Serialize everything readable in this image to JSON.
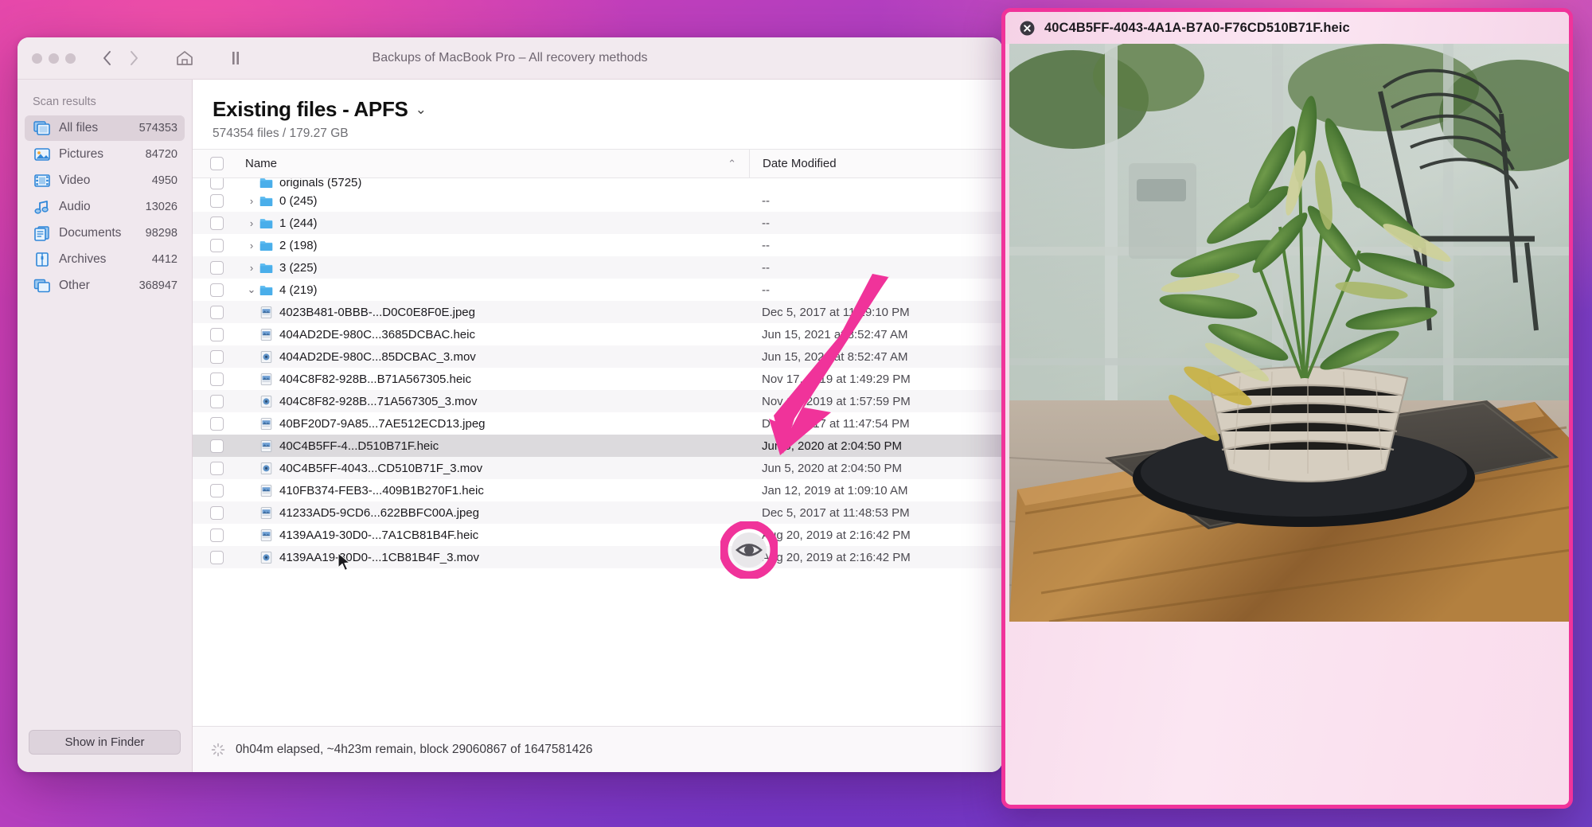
{
  "window": {
    "title": "Backups of MacBook Pro – All recovery methods",
    "toolbar": {
      "back_icon": "chevron-left-icon",
      "forward_icon": "chevron-right-icon",
      "home_icon": "home-icon",
      "pause_icon": "pause-icon"
    }
  },
  "sidebar": {
    "heading": "Scan results",
    "items": [
      {
        "label": "All files",
        "count": "574353",
        "icon": "all-files-icon",
        "selected": true
      },
      {
        "label": "Pictures",
        "count": "84720",
        "icon": "pictures-icon",
        "selected": false
      },
      {
        "label": "Video",
        "count": "4950",
        "icon": "video-icon",
        "selected": false
      },
      {
        "label": "Audio",
        "count": "13026",
        "icon": "audio-icon",
        "selected": false
      },
      {
        "label": "Documents",
        "count": "98298",
        "icon": "documents-icon",
        "selected": false
      },
      {
        "label": "Archives",
        "count": "4412",
        "icon": "archives-icon",
        "selected": false
      },
      {
        "label": "Other",
        "count": "368947",
        "icon": "other-icon",
        "selected": false
      }
    ],
    "show_in_finder": "Show in Finder"
  },
  "main": {
    "title": "Existing files - APFS",
    "title_chevron": "chevron-down-icon",
    "subtitle": "574354 files / 179.27 GB",
    "columns": {
      "name": "Name",
      "date": "Date Modified",
      "sort_caret": "caret-up-icon"
    },
    "rows": [
      {
        "name": "originals (5725)",
        "date": "",
        "type": "folder",
        "indent": 1,
        "twisty": "",
        "clipped": true,
        "alt": false
      },
      {
        "name": "0 (245)",
        "date": "--",
        "type": "folder",
        "indent": 1,
        "twisty": "collapsed",
        "alt": false
      },
      {
        "name": "1 (244)",
        "date": "--",
        "type": "folder",
        "indent": 1,
        "twisty": "collapsed",
        "alt": true
      },
      {
        "name": "2 (198)",
        "date": "--",
        "type": "folder",
        "indent": 1,
        "twisty": "collapsed",
        "alt": false
      },
      {
        "name": "3 (225)",
        "date": "--",
        "type": "folder",
        "indent": 1,
        "twisty": "collapsed",
        "alt": true
      },
      {
        "name": "4 (219)",
        "date": "--",
        "type": "folder",
        "indent": 1,
        "twisty": "expanded",
        "alt": false
      },
      {
        "name": "4023B481-0BBB-...D0C0E8F0E.jpeg",
        "date": "Dec 5, 2017 at 11:29:10 PM",
        "type": "image",
        "indent": 2,
        "twisty": "",
        "alt": true
      },
      {
        "name": "404AD2DE-980C...3685DCBAC.heic",
        "date": "Jun 15, 2021 at 8:52:47 AM",
        "type": "image",
        "indent": 2,
        "twisty": "",
        "alt": false
      },
      {
        "name": "404AD2DE-980C...85DCBAC_3.mov",
        "date": "Jun 15, 2021 at 8:52:47 AM",
        "type": "video",
        "indent": 2,
        "twisty": "",
        "alt": true
      },
      {
        "name": "404C8F82-928B...B71A567305.heic",
        "date": "Nov 17, 2019 at 1:49:29 PM",
        "type": "image",
        "indent": 2,
        "twisty": "",
        "alt": false
      },
      {
        "name": "404C8F82-928B...71A567305_3.mov",
        "date": "Nov 17, 2019 at 1:57:59 PM",
        "type": "video",
        "indent": 2,
        "twisty": "",
        "alt": true
      },
      {
        "name": "40BF20D7-9A85...7AE512ECD13.jpeg",
        "date": "Dec 5, 2017 at 11:47:54 PM",
        "type": "image",
        "indent": 2,
        "twisty": "",
        "alt": false
      },
      {
        "name": "40C4B5FF-4...D510B71F.heic",
        "date": "Jun 5, 2020 at 2:04:50 PM",
        "type": "image",
        "indent": 2,
        "twisty": "",
        "alt": false,
        "selected": true
      },
      {
        "name": "40C4B5FF-4043...CD510B71F_3.mov",
        "date": "Jun 5, 2020 at 2:04:50 PM",
        "type": "video",
        "indent": 2,
        "twisty": "",
        "alt": true
      },
      {
        "name": "410FB374-FEB3-...409B1B270F1.heic",
        "date": "Jan 12, 2019 at 1:09:10 AM",
        "type": "image",
        "indent": 2,
        "twisty": "",
        "alt": false
      },
      {
        "name": "41233AD5-9CD6...622BBFC00A.jpeg",
        "date": "Dec 5, 2017 at 11:48:53 PM",
        "type": "image",
        "indent": 2,
        "twisty": "",
        "alt": true
      },
      {
        "name": "4139AA19-30D0-...7A1CB81B4F.heic",
        "date": "Aug 20, 2019 at 2:16:42 PM",
        "type": "image",
        "indent": 2,
        "twisty": "",
        "alt": false
      },
      {
        "name": "4139AA19-30D0-...1CB81B4F_3.mov",
        "date": "Aug 20, 2019 at 2:16:42 PM",
        "type": "video",
        "indent": 2,
        "twisty": "",
        "alt": true
      }
    ]
  },
  "status": {
    "text": "0h04m elapsed, ~4h23m remain, block 29060867 of 1647581426",
    "spinner_icon": "spinner-icon"
  },
  "preview": {
    "title": "40C4B5FF-4043-4A1A-B7A0-F76CD510B71F.heic",
    "close_icon": "close-circle-icon",
    "image_description": "potted bamboo plant on a balcony table"
  },
  "annotations": {
    "arrow_icon": "arrow-pointer-icon",
    "highlight_icon": "eye-quicklook-highlight-icon",
    "cursor_icon": "mouse-cursor-icon",
    "accent_color": "#f0339a"
  }
}
